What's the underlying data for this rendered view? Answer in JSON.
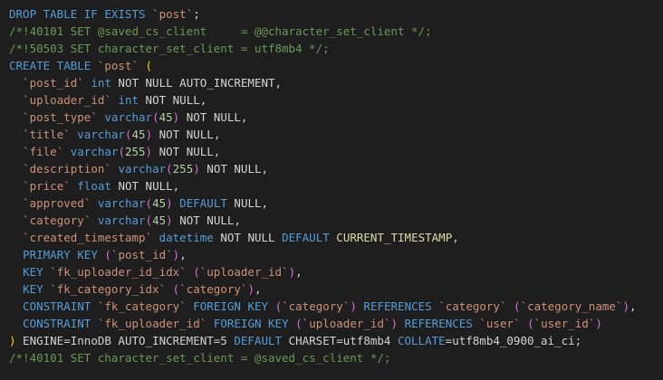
{
  "editor": {
    "language": "sql",
    "lines": [
      [
        [
          "keyword",
          "DROP TABLE IF EXISTS "
        ],
        [
          "ident",
          "`post`"
        ],
        [
          "plain",
          ";"
        ]
      ],
      [
        [
          "comment",
          "/*!40101 SET @saved_cs_client     = @@character_set_client */;"
        ]
      ],
      [
        [
          "comment",
          "/*!50503 SET character_set_client = utf8mb4 */;"
        ]
      ],
      [
        [
          "keyword",
          "CREATE TABLE "
        ],
        [
          "ident",
          "`post`"
        ],
        [
          "plain",
          " "
        ],
        [
          "bracket1",
          "("
        ]
      ],
      [
        [
          "plain",
          "  "
        ],
        [
          "ident",
          "`post_id`"
        ],
        [
          "plain",
          " "
        ],
        [
          "keyword",
          "int"
        ],
        [
          "plain",
          " NOT NULL AUTO_INCREMENT,"
        ]
      ],
      [
        [
          "plain",
          "  "
        ],
        [
          "ident",
          "`uploader_id`"
        ],
        [
          "plain",
          " "
        ],
        [
          "keyword",
          "int"
        ],
        [
          "plain",
          " NOT NULL,"
        ]
      ],
      [
        [
          "plain",
          "  "
        ],
        [
          "ident",
          "`post_type`"
        ],
        [
          "plain",
          " "
        ],
        [
          "keyword",
          "varchar"
        ],
        [
          "bracket2",
          "("
        ],
        [
          "number",
          "45"
        ],
        [
          "bracket2",
          ")"
        ],
        [
          "plain",
          " NOT NULL,"
        ]
      ],
      [
        [
          "plain",
          "  "
        ],
        [
          "ident",
          "`title`"
        ],
        [
          "plain",
          " "
        ],
        [
          "keyword",
          "varchar"
        ],
        [
          "bracket2",
          "("
        ],
        [
          "number",
          "45"
        ],
        [
          "bracket2",
          ")"
        ],
        [
          "plain",
          " NOT NULL,"
        ]
      ],
      [
        [
          "plain",
          "  "
        ],
        [
          "ident",
          "`file`"
        ],
        [
          "plain",
          " "
        ],
        [
          "keyword",
          "varchar"
        ],
        [
          "bracket2",
          "("
        ],
        [
          "number",
          "255"
        ],
        [
          "bracket2",
          ")"
        ],
        [
          "plain",
          " NOT NULL,"
        ]
      ],
      [
        [
          "plain",
          "  "
        ],
        [
          "ident",
          "`description`"
        ],
        [
          "plain",
          " "
        ],
        [
          "keyword",
          "varchar"
        ],
        [
          "bracket2",
          "("
        ],
        [
          "number",
          "255"
        ],
        [
          "bracket2",
          ")"
        ],
        [
          "plain",
          " NOT NULL,"
        ]
      ],
      [
        [
          "plain",
          "  "
        ],
        [
          "ident",
          "`price`"
        ],
        [
          "plain",
          " "
        ],
        [
          "keyword",
          "float"
        ],
        [
          "plain",
          " NOT NULL,"
        ]
      ],
      [
        [
          "plain",
          "  "
        ],
        [
          "ident",
          "`approved`"
        ],
        [
          "plain",
          " "
        ],
        [
          "keyword",
          "varchar"
        ],
        [
          "bracket2",
          "("
        ],
        [
          "number",
          "45"
        ],
        [
          "bracket2",
          ")"
        ],
        [
          "plain",
          " "
        ],
        [
          "keyword",
          "DEFAULT"
        ],
        [
          "plain",
          " NULL,"
        ]
      ],
      [
        [
          "plain",
          "  "
        ],
        [
          "ident",
          "`category`"
        ],
        [
          "plain",
          " "
        ],
        [
          "keyword",
          "varchar"
        ],
        [
          "bracket2",
          "("
        ],
        [
          "number",
          "45"
        ],
        [
          "bracket2",
          ")"
        ],
        [
          "plain",
          " NOT NULL,"
        ]
      ],
      [
        [
          "plain",
          "  "
        ],
        [
          "ident",
          "`created_timestamp`"
        ],
        [
          "plain",
          " "
        ],
        [
          "keyword",
          "datetime"
        ],
        [
          "plain",
          " NOT NULL "
        ],
        [
          "keyword",
          "DEFAULT"
        ],
        [
          "plain",
          " "
        ],
        [
          "function",
          "CURRENT_TIMESTAMP"
        ],
        [
          "plain",
          ","
        ]
      ],
      [
        [
          "plain",
          "  "
        ],
        [
          "keyword",
          "PRIMARY KEY"
        ],
        [
          "plain",
          " "
        ],
        [
          "bracket2",
          "("
        ],
        [
          "ident",
          "`post_id`"
        ],
        [
          "bracket2",
          ")"
        ],
        [
          "plain",
          ","
        ]
      ],
      [
        [
          "plain",
          "  "
        ],
        [
          "keyword",
          "KEY"
        ],
        [
          "plain",
          " "
        ],
        [
          "ident",
          "`fk_uploader_id_idx`"
        ],
        [
          "plain",
          " "
        ],
        [
          "bracket2",
          "("
        ],
        [
          "ident",
          "`uploader_id`"
        ],
        [
          "bracket2",
          ")"
        ],
        [
          "plain",
          ","
        ]
      ],
      [
        [
          "plain",
          "  "
        ],
        [
          "keyword",
          "KEY"
        ],
        [
          "plain",
          " "
        ],
        [
          "ident",
          "`fk_category_idx`"
        ],
        [
          "plain",
          " "
        ],
        [
          "bracket2",
          "("
        ],
        [
          "ident",
          "`category`"
        ],
        [
          "bracket2",
          ")"
        ],
        [
          "plain",
          ","
        ]
      ],
      [
        [
          "plain",
          "  "
        ],
        [
          "keyword",
          "CONSTRAINT"
        ],
        [
          "plain",
          " "
        ],
        [
          "ident",
          "`fk_category`"
        ],
        [
          "plain",
          " "
        ],
        [
          "keyword",
          "FOREIGN KEY"
        ],
        [
          "plain",
          " "
        ],
        [
          "bracket2",
          "("
        ],
        [
          "ident",
          "`category`"
        ],
        [
          "bracket2",
          ")"
        ],
        [
          "plain",
          " "
        ],
        [
          "keyword",
          "REFERENCES"
        ],
        [
          "plain",
          " "
        ],
        [
          "ident",
          "`category`"
        ],
        [
          "plain",
          " "
        ],
        [
          "bracket2",
          "("
        ],
        [
          "ident",
          "`category_name`"
        ],
        [
          "bracket2",
          ")"
        ],
        [
          "plain",
          ","
        ]
      ],
      [
        [
          "plain",
          "  "
        ],
        [
          "keyword",
          "CONSTRAINT"
        ],
        [
          "plain",
          " "
        ],
        [
          "ident",
          "`fk_uploader_id`"
        ],
        [
          "plain",
          " "
        ],
        [
          "keyword",
          "FOREIGN KEY"
        ],
        [
          "plain",
          " "
        ],
        [
          "bracket2",
          "("
        ],
        [
          "ident",
          "`uploader_id`"
        ],
        [
          "bracket2",
          ")"
        ],
        [
          "plain",
          " "
        ],
        [
          "keyword",
          "REFERENCES"
        ],
        [
          "plain",
          " "
        ],
        [
          "ident",
          "`user`"
        ],
        [
          "plain",
          " "
        ],
        [
          "bracket2",
          "("
        ],
        [
          "ident",
          "`user_id`"
        ],
        [
          "bracket2",
          ")"
        ]
      ],
      [
        [
          "bracket1",
          ")"
        ],
        [
          "plain",
          " ENGINE=InnoDB AUTO_INCREMENT=5 "
        ],
        [
          "keyword",
          "DEFAULT"
        ],
        [
          "plain",
          " CHARSET=utf8mb4 "
        ],
        [
          "keyword",
          "COLLATE"
        ],
        [
          "plain",
          "=utf8mb4_0900_ai_ci;"
        ]
      ],
      [
        [
          "comment",
          "/*!40101 SET character_set_client = @saved_cs_client */;"
        ]
      ]
    ]
  }
}
